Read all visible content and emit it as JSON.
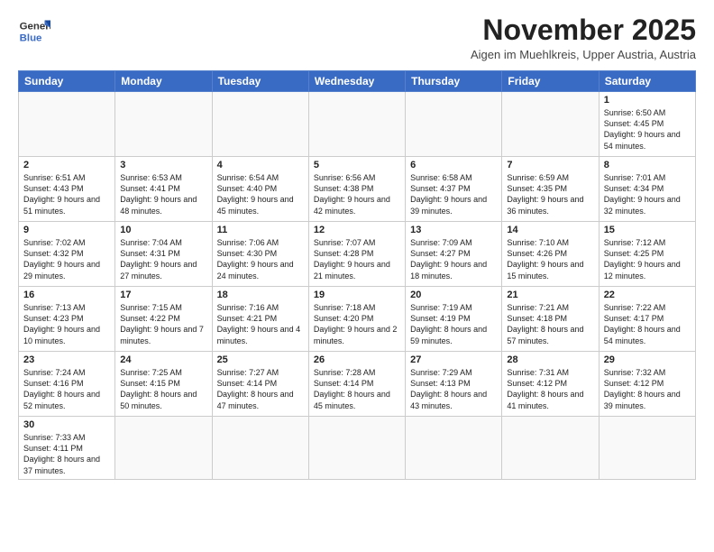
{
  "header": {
    "logo_line1": "General",
    "logo_line2": "Blue",
    "month_year": "November 2025",
    "location": "Aigen im Muehlkreis, Upper Austria, Austria"
  },
  "weekdays": [
    "Sunday",
    "Monday",
    "Tuesday",
    "Wednesday",
    "Thursday",
    "Friday",
    "Saturday"
  ],
  "weeks": [
    [
      {
        "day": "",
        "info": ""
      },
      {
        "day": "",
        "info": ""
      },
      {
        "day": "",
        "info": ""
      },
      {
        "day": "",
        "info": ""
      },
      {
        "day": "",
        "info": ""
      },
      {
        "day": "",
        "info": ""
      },
      {
        "day": "1",
        "info": "Sunrise: 6:50 AM\nSunset: 4:45 PM\nDaylight: 9 hours and 54 minutes."
      }
    ],
    [
      {
        "day": "2",
        "info": "Sunrise: 6:51 AM\nSunset: 4:43 PM\nDaylight: 9 hours and 51 minutes."
      },
      {
        "day": "3",
        "info": "Sunrise: 6:53 AM\nSunset: 4:41 PM\nDaylight: 9 hours and 48 minutes."
      },
      {
        "day": "4",
        "info": "Sunrise: 6:54 AM\nSunset: 4:40 PM\nDaylight: 9 hours and 45 minutes."
      },
      {
        "day": "5",
        "info": "Sunrise: 6:56 AM\nSunset: 4:38 PM\nDaylight: 9 hours and 42 minutes."
      },
      {
        "day": "6",
        "info": "Sunrise: 6:58 AM\nSunset: 4:37 PM\nDaylight: 9 hours and 39 minutes."
      },
      {
        "day": "7",
        "info": "Sunrise: 6:59 AM\nSunset: 4:35 PM\nDaylight: 9 hours and 36 minutes."
      },
      {
        "day": "8",
        "info": "Sunrise: 7:01 AM\nSunset: 4:34 PM\nDaylight: 9 hours and 32 minutes."
      }
    ],
    [
      {
        "day": "9",
        "info": "Sunrise: 7:02 AM\nSunset: 4:32 PM\nDaylight: 9 hours and 29 minutes."
      },
      {
        "day": "10",
        "info": "Sunrise: 7:04 AM\nSunset: 4:31 PM\nDaylight: 9 hours and 27 minutes."
      },
      {
        "day": "11",
        "info": "Sunrise: 7:06 AM\nSunset: 4:30 PM\nDaylight: 9 hours and 24 minutes."
      },
      {
        "day": "12",
        "info": "Sunrise: 7:07 AM\nSunset: 4:28 PM\nDaylight: 9 hours and 21 minutes."
      },
      {
        "day": "13",
        "info": "Sunrise: 7:09 AM\nSunset: 4:27 PM\nDaylight: 9 hours and 18 minutes."
      },
      {
        "day": "14",
        "info": "Sunrise: 7:10 AM\nSunset: 4:26 PM\nDaylight: 9 hours and 15 minutes."
      },
      {
        "day": "15",
        "info": "Sunrise: 7:12 AM\nSunset: 4:25 PM\nDaylight: 9 hours and 12 minutes."
      }
    ],
    [
      {
        "day": "16",
        "info": "Sunrise: 7:13 AM\nSunset: 4:23 PM\nDaylight: 9 hours and 10 minutes."
      },
      {
        "day": "17",
        "info": "Sunrise: 7:15 AM\nSunset: 4:22 PM\nDaylight: 9 hours and 7 minutes."
      },
      {
        "day": "18",
        "info": "Sunrise: 7:16 AM\nSunset: 4:21 PM\nDaylight: 9 hours and 4 minutes."
      },
      {
        "day": "19",
        "info": "Sunrise: 7:18 AM\nSunset: 4:20 PM\nDaylight: 9 hours and 2 minutes."
      },
      {
        "day": "20",
        "info": "Sunrise: 7:19 AM\nSunset: 4:19 PM\nDaylight: 8 hours and 59 minutes."
      },
      {
        "day": "21",
        "info": "Sunrise: 7:21 AM\nSunset: 4:18 PM\nDaylight: 8 hours and 57 minutes."
      },
      {
        "day": "22",
        "info": "Sunrise: 7:22 AM\nSunset: 4:17 PM\nDaylight: 8 hours and 54 minutes."
      }
    ],
    [
      {
        "day": "23",
        "info": "Sunrise: 7:24 AM\nSunset: 4:16 PM\nDaylight: 8 hours and 52 minutes."
      },
      {
        "day": "24",
        "info": "Sunrise: 7:25 AM\nSunset: 4:15 PM\nDaylight: 8 hours and 50 minutes."
      },
      {
        "day": "25",
        "info": "Sunrise: 7:27 AM\nSunset: 4:14 PM\nDaylight: 8 hours and 47 minutes."
      },
      {
        "day": "26",
        "info": "Sunrise: 7:28 AM\nSunset: 4:14 PM\nDaylight: 8 hours and 45 minutes."
      },
      {
        "day": "27",
        "info": "Sunrise: 7:29 AM\nSunset: 4:13 PM\nDaylight: 8 hours and 43 minutes."
      },
      {
        "day": "28",
        "info": "Sunrise: 7:31 AM\nSunset: 4:12 PM\nDaylight: 8 hours and 41 minutes."
      },
      {
        "day": "29",
        "info": "Sunrise: 7:32 AM\nSunset: 4:12 PM\nDaylight: 8 hours and 39 minutes."
      }
    ],
    [
      {
        "day": "30",
        "info": "Sunrise: 7:33 AM\nSunset: 4:11 PM\nDaylight: 8 hours and 37 minutes."
      },
      {
        "day": "",
        "info": ""
      },
      {
        "day": "",
        "info": ""
      },
      {
        "day": "",
        "info": ""
      },
      {
        "day": "",
        "info": ""
      },
      {
        "day": "",
        "info": ""
      },
      {
        "day": "",
        "info": ""
      }
    ]
  ]
}
